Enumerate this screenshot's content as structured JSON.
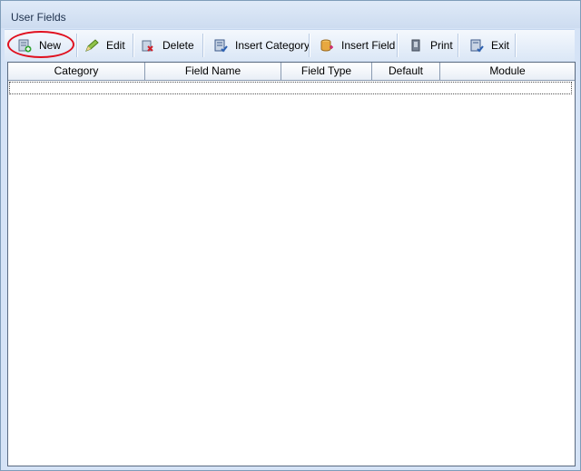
{
  "window": {
    "title": "User Fields"
  },
  "toolbar": {
    "buttons": [
      {
        "label": "New",
        "icon": "new-record-icon"
      },
      {
        "label": "Edit",
        "icon": "pencil-icon"
      },
      {
        "label": "Delete",
        "icon": "delete-icon"
      },
      {
        "label": "Insert Category",
        "icon": "insert-category-icon"
      },
      {
        "label": "Insert Field",
        "icon": "insert-field-icon"
      },
      {
        "label": "Print",
        "icon": "printer-icon"
      },
      {
        "label": "Exit",
        "icon": "exit-icon"
      }
    ]
  },
  "grid": {
    "columns": [
      "Category",
      "Field Name",
      "Field Type",
      "Default",
      "Module"
    ],
    "rows": []
  },
  "colors": {
    "highlight": "#e0101e",
    "border": "#7f9db9",
    "toolbar": "#dbe7f6"
  }
}
